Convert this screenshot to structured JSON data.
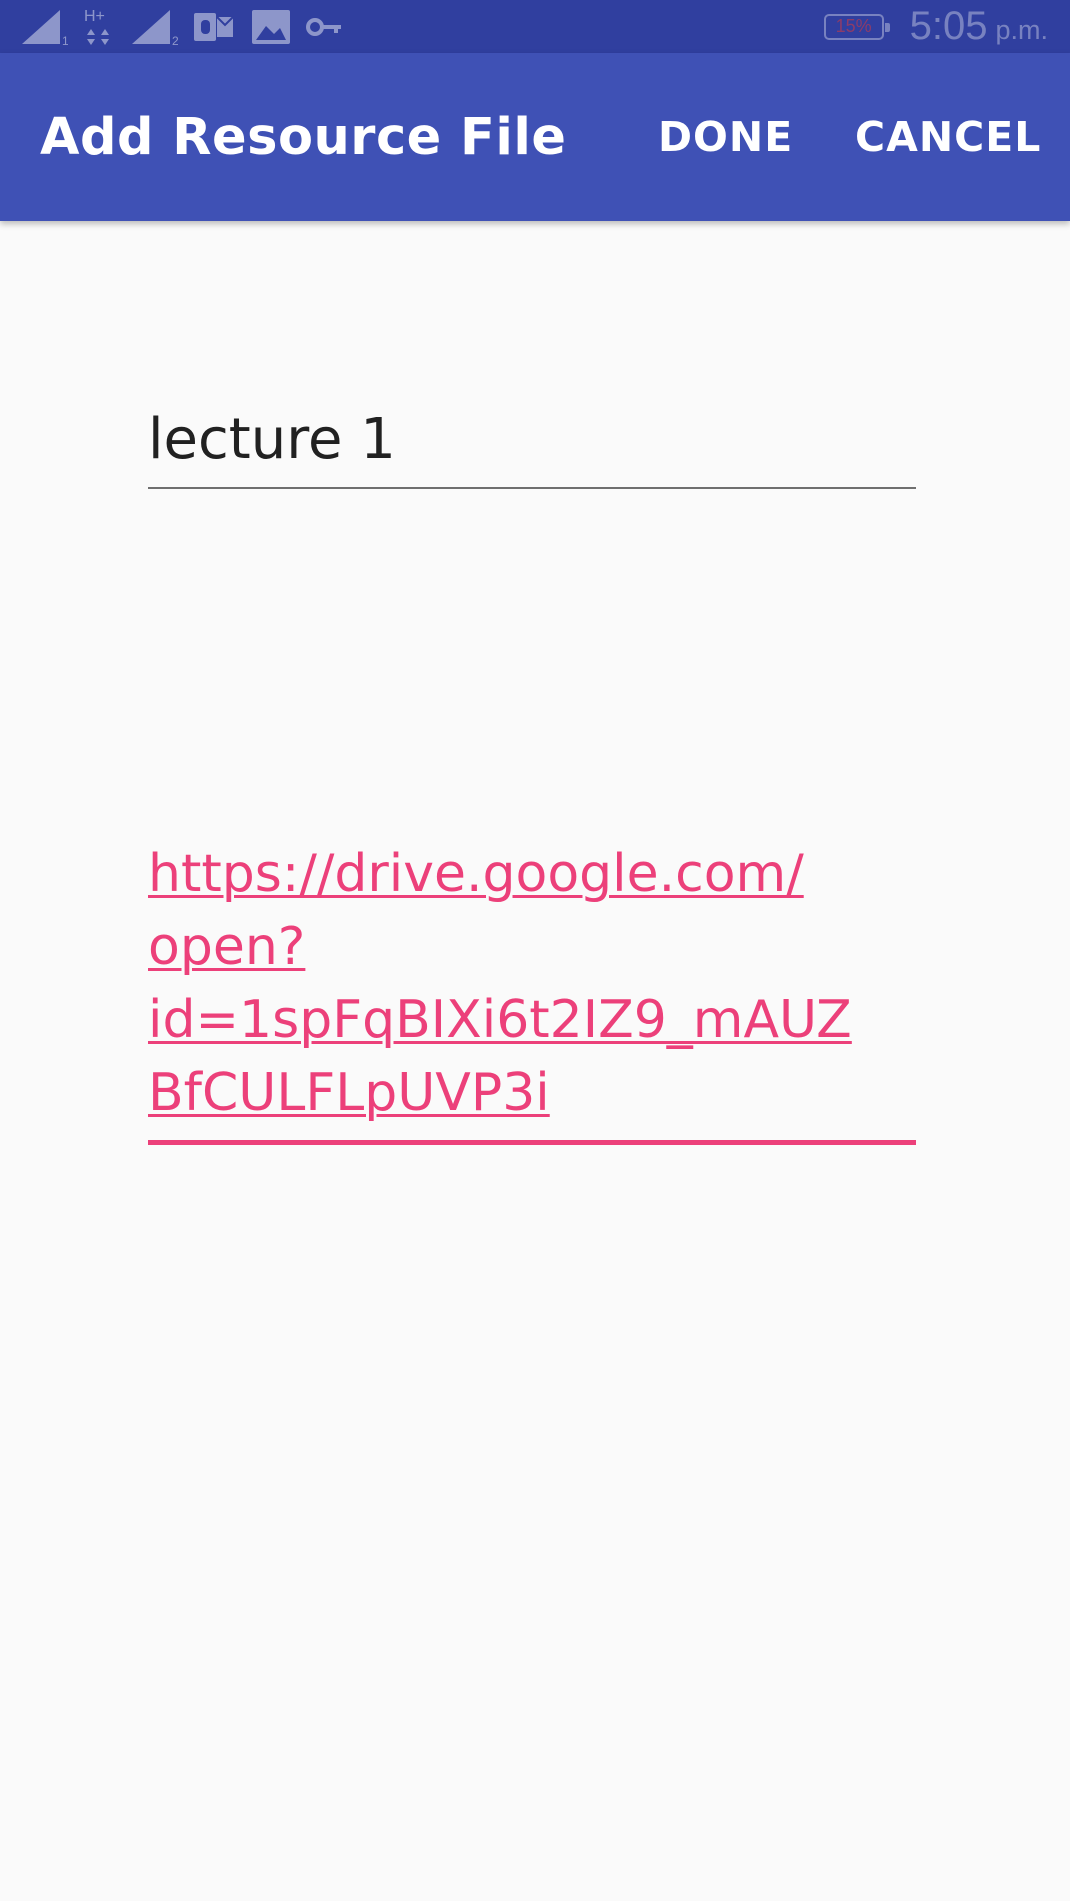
{
  "status_bar": {
    "sim1_label": "1",
    "sim2_label": "2",
    "network_type": "H+",
    "battery": "15%",
    "time": "5:05",
    "ampm": "p.m.",
    "icons": [
      "signal-icon",
      "network-data-icon",
      "signal-icon",
      "outlook-icon",
      "gallery-icon",
      "vpn-key-icon",
      "battery-icon"
    ]
  },
  "app_bar": {
    "title": "Add Resource File",
    "done_label": "DONE",
    "cancel_label": "CANCEL"
  },
  "form": {
    "name_value": "lecture 1",
    "url_lines": [
      "https://drive.google.com/",
      "open?",
      "id=1spFqBIXi6t2IZ9_mAUZ",
      "BfCULFLpUVP3i"
    ]
  },
  "colors": {
    "status_bar": "#303f9f",
    "app_bar": "#3f51b5",
    "accent": "#ec407a",
    "background": "#fafafa"
  }
}
